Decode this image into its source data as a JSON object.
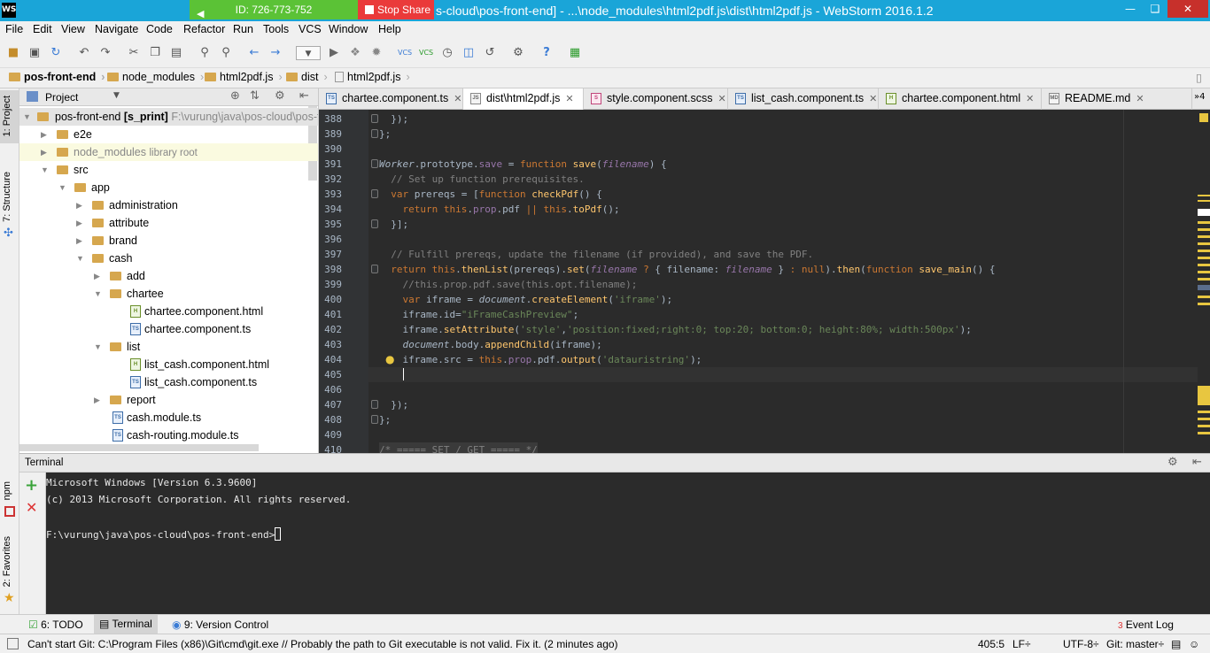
{
  "window": {
    "title": "s-cloud\\pos-front-end] - ...\\node_modules\\html2pdf.js\\dist\\html2pdf.js - WebStorm 2016.1.2",
    "app_badge": "WS",
    "share_id": "ID: 726-773-752",
    "stop_share": "Stop Share"
  },
  "menu": [
    "File",
    "Edit",
    "View",
    "Navigate",
    "Code",
    "Refactor",
    "Run",
    "Tools",
    "VCS",
    "Window",
    "Help"
  ],
  "breadcrumbs": [
    "pos-front-end",
    "node_modules",
    "html2pdf.js",
    "dist",
    "html2pdf.js"
  ],
  "left_tabs": {
    "project": "1: Project",
    "structure": "7: Structure",
    "npm": "npm",
    "favorites": "2: Favorites"
  },
  "project": {
    "header": "Project",
    "root_label": "pos-front-end",
    "root_branch": "[s_print]",
    "root_path": "F:\\vurung\\java\\pos-cloud\\pos-fr",
    "items": [
      {
        "label": "e2e",
        "note": ""
      },
      {
        "label": "node_modules",
        "note": "library root"
      },
      {
        "label": "src",
        "note": ""
      },
      {
        "label": "app",
        "note": ""
      },
      {
        "label": "administration",
        "note": ""
      },
      {
        "label": "attribute",
        "note": ""
      },
      {
        "label": "brand",
        "note": ""
      },
      {
        "label": "cash",
        "note": ""
      },
      {
        "label": "add",
        "note": ""
      },
      {
        "label": "chartee",
        "note": ""
      },
      {
        "label": "chartee.component.html",
        "note": ""
      },
      {
        "label": "chartee.component.ts",
        "note": ""
      },
      {
        "label": "list",
        "note": ""
      },
      {
        "label": "list_cash.component.html",
        "note": ""
      },
      {
        "label": "list_cash.component.ts",
        "note": ""
      },
      {
        "label": "report",
        "note": ""
      },
      {
        "label": "cash.module.ts",
        "note": ""
      },
      {
        "label": "cash-routing.module.ts",
        "note": ""
      }
    ]
  },
  "tabs": [
    {
      "label": "chartee.component.ts",
      "icon": "TS"
    },
    {
      "label": "dist\\html2pdf.js",
      "icon": "JS"
    },
    {
      "label": "style.component.scss",
      "icon": "S"
    },
    {
      "label": "list_cash.component.ts",
      "icon": "TS"
    },
    {
      "label": "chartee.component.html",
      "icon": "H"
    },
    {
      "label": "README.md",
      "icon": "MD"
    }
  ],
  "tabs_overflow": "»4",
  "line_numbers": [
    "388",
    "389",
    "390",
    "391",
    "392",
    "393",
    "394",
    "395",
    "396",
    "397",
    "398",
    "399",
    "400",
    "401",
    "402",
    "403",
    "404",
    "405",
    "406",
    "407",
    "408",
    "409",
    "410"
  ],
  "terminal": {
    "title": "Terminal",
    "lines": [
      "Microsoft Windows [Version 6.3.9600]",
      "(c) 2013 Microsoft Corporation. All rights reserved.",
      "",
      "F:\\vurung\\java\\pos-cloud\\pos-front-end>"
    ]
  },
  "bottom_tabs": {
    "todo": "6: TODO",
    "terminal": "Terminal",
    "vc": "9: Version Control",
    "event_log": "Event Log",
    "event_count": "3"
  },
  "status": {
    "message": "Can't start Git: C:\\Program Files (x86)\\Git\\cmd\\git.exe // Probably the path to Git executable is not valid. Fix it. (2 minutes ago)",
    "position": "405:5",
    "line_sep": "LF÷",
    "encoding": "UTF-8÷",
    "git": "Git: master÷"
  }
}
